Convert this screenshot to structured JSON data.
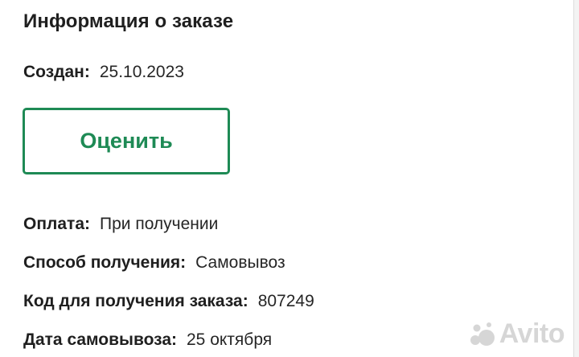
{
  "order": {
    "title": "Информация о заказе",
    "created_label": "Создан:",
    "created_value": "25.10.2023",
    "rate_button_label": "Оценить",
    "payment_label": "Оплата:",
    "payment_value": "При получении",
    "delivery_label": "Способ получения:",
    "delivery_value": "Самовывоз",
    "pickup_code_label": "Код для получения заказа:",
    "pickup_code_value": "807249",
    "pickup_date_label": "Дата самовывоза:",
    "pickup_date_value": "25 октября"
  },
  "watermark": {
    "text": "Avito",
    "icon": "avito-logo-icon"
  },
  "colors": {
    "accent": "#1e8a55",
    "text": "#1f1f1f",
    "background": "#ffffff"
  }
}
